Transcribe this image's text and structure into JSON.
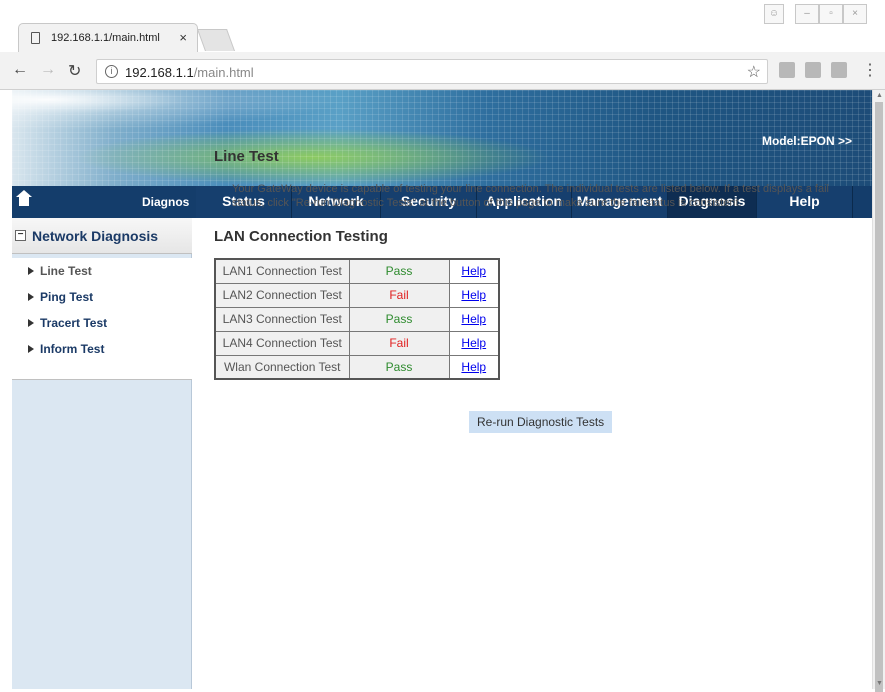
{
  "browser": {
    "tab_title": "192.168.1.1/main.html",
    "tab_close": "×",
    "url_host": "192.168.1.1",
    "url_path": "/main.html",
    "icons": [
      "back-icon",
      "forward-icon",
      "reload-icon",
      "info-icon",
      "star-icon",
      "menu-icon"
    ]
  },
  "header": {
    "model": "Model:EPON >>",
    "home_label": "Diagnos",
    "nav": [
      "Status",
      "Network",
      "Security",
      "Application",
      "Management",
      "Diagnosis",
      "Help"
    ],
    "active_nav": "Diagnosis"
  },
  "sidebar": {
    "title": "Network Diagnosis",
    "items": [
      {
        "label": "Line Test"
      },
      {
        "label": "Ping Test"
      },
      {
        "label": "Tracert Test"
      },
      {
        "label": "Inform Test"
      }
    ]
  },
  "main": {
    "title": "Line Test",
    "description": "Your GateWay device is capable of testing your line connection. The individual tests are listed below. If a test displays a fail status, click \"Re-run Diagnostic Tests\" at the button of this page to make sure the fail status is consistent.",
    "lan_title": "LAN Connection Testing",
    "tests": [
      {
        "name": "LAN1 Connection Test",
        "result": "Pass",
        "help": "Help"
      },
      {
        "name": "LAN2 Connection Test",
        "result": "Fail",
        "help": "Help"
      },
      {
        "name": "LAN3 Connection Test",
        "result": "Pass",
        "help": "Help"
      },
      {
        "name": "LAN4 Connection Test",
        "result": "Fail",
        "help": "Help"
      },
      {
        "name": "Wlan Connection Test",
        "result": "Pass",
        "help": "Help"
      }
    ],
    "rerun_label": "Re-run Diagnostic Tests"
  },
  "colors": {
    "nav_bg": "#143d6b",
    "pass": "#2e8b2e",
    "fail": "#e02020",
    "link": "#0000ee"
  }
}
